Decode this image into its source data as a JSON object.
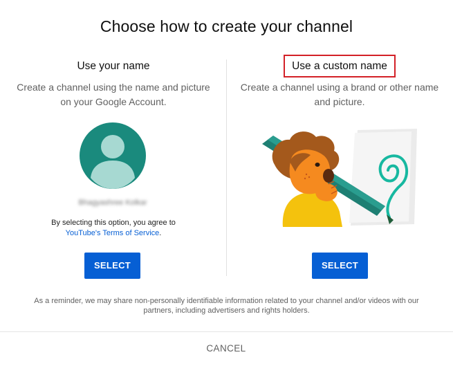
{
  "dialog": {
    "title": "Choose how to create your channel",
    "reminder": "As a reminder, we may share non-personally identifiable information related to your channel and/or videos with our partners, including advertisers and rights holders.",
    "cancel_label": "CANCEL"
  },
  "left_option": {
    "title": "Use your name",
    "description": "Create a channel using the name and picture on your Google Account.",
    "account_name": "Bhagyashree Kolkar",
    "terms_prefix": "By selecting this option, you agree to",
    "terms_link": "YouTube's Terms of Service",
    "terms_suffix": ".",
    "select_label": "SELECT"
  },
  "right_option": {
    "title": "Use a custom name",
    "description": "Create a channel using a brand or other name and picture.",
    "select_label": "SELECT"
  },
  "colors": {
    "accent_blue": "#065fd4",
    "highlight_red": "#d32027",
    "avatar_teal": "#1a8a7d",
    "avatar_light": "#a7d9d2"
  },
  "icons": {
    "avatar": "default-profile-icon",
    "illustration": "custom-channel-illustration"
  }
}
